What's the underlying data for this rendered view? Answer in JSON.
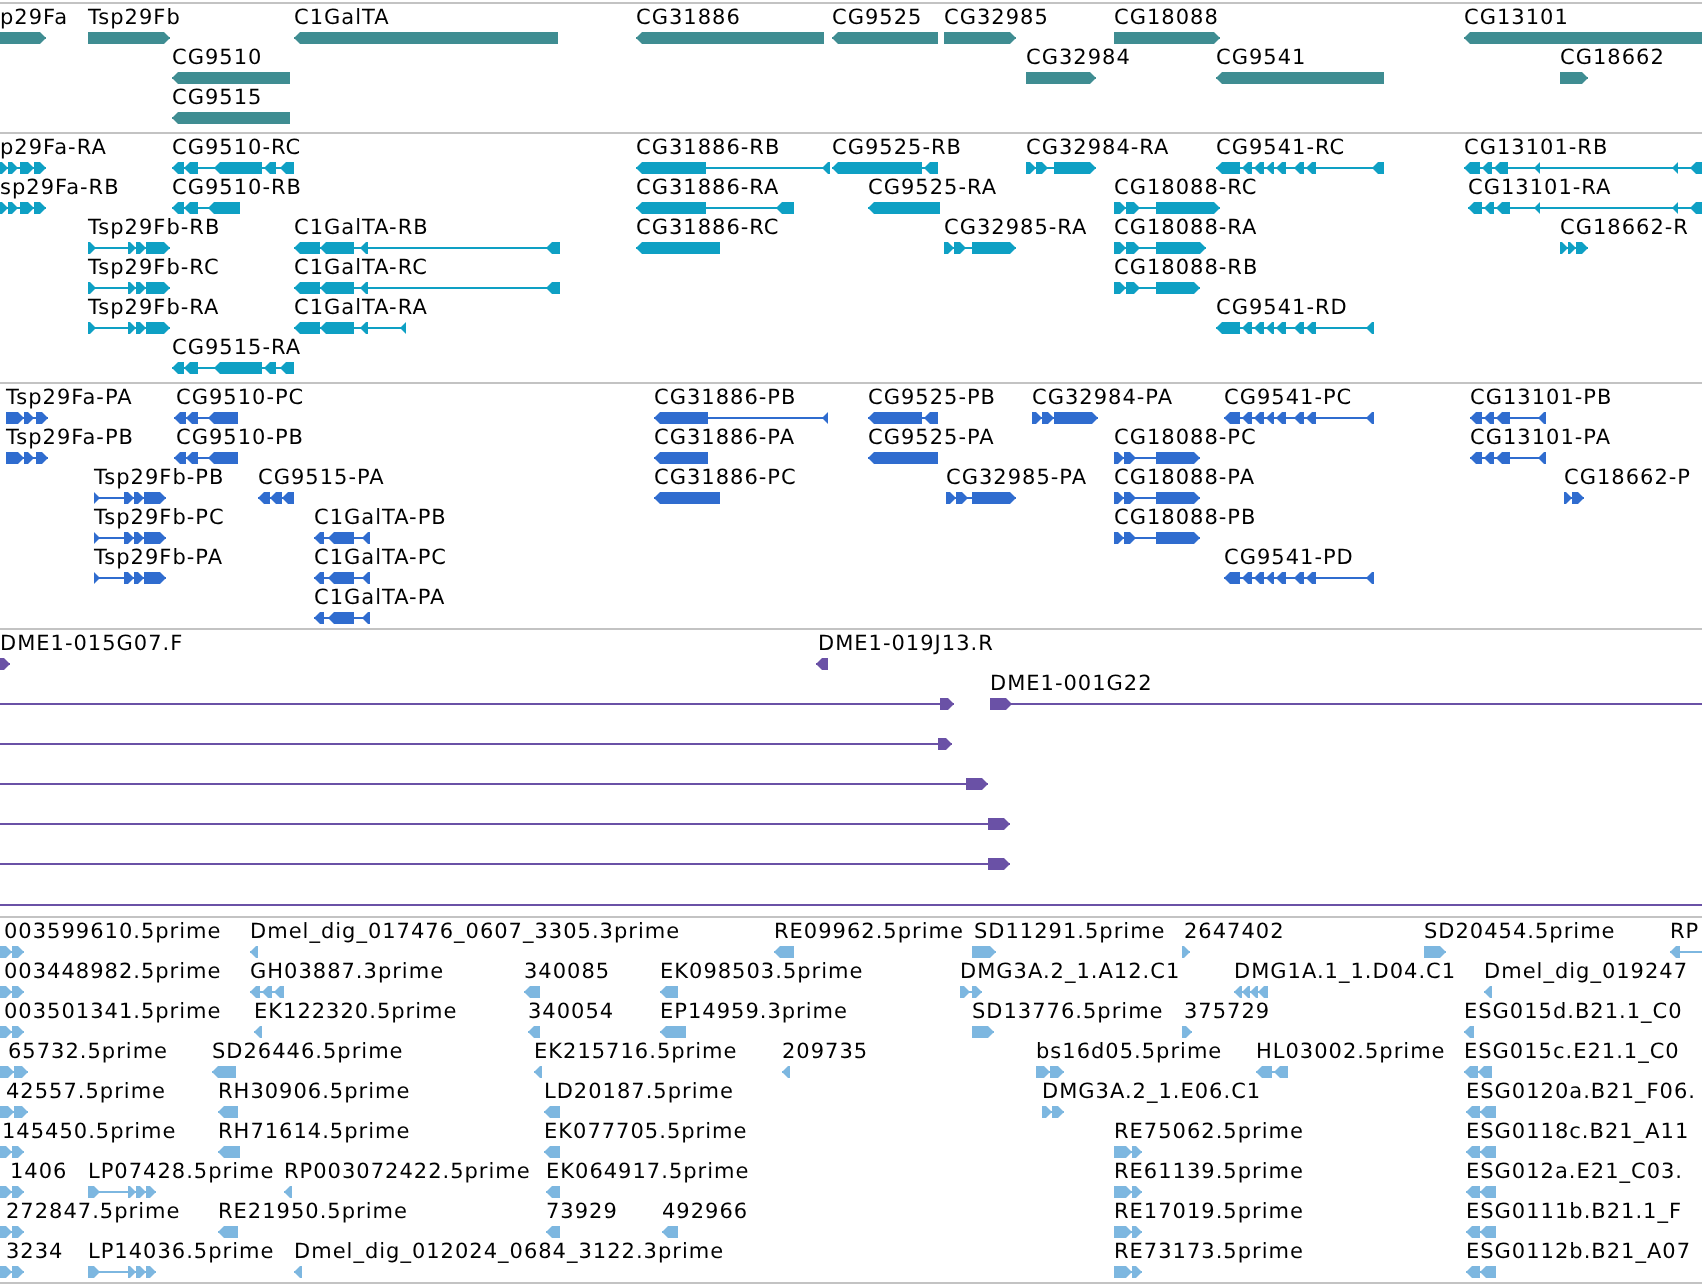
{
  "tracks": [
    {
      "kind": "gene",
      "rows": [
        {
          "features": [
            {
              "label": "p29Fa",
              "reverse": false
            },
            {
              "label": "Tsp29Fb",
              "reverse": false
            },
            {
              "label": "C1GalTA",
              "reverse": true
            },
            {
              "label": "CG31886",
              "reverse": true
            },
            {
              "label": "CG9525",
              "reverse": true
            },
            {
              "label": "CG32985",
              "reverse": false
            },
            {
              "label": "CG18088",
              "reverse": false
            },
            {
              "label": "CG13101",
              "reverse": true
            }
          ]
        },
        {
          "features": [
            {
              "label": "CG9510",
              "reverse": true
            },
            {
              "label": "CG32984",
              "reverse": false
            },
            {
              "label": "CG9541",
              "reverse": true
            },
            {
              "label": "CG18662",
              "reverse": false
            }
          ]
        },
        {
          "features": [
            {
              "label": "CG9515",
              "reverse": true
            }
          ]
        }
      ]
    },
    {
      "kind": "transcript",
      "rows": [
        {
          "features": [
            {
              "label": "p29Fa-RA",
              "reverse": false
            },
            {
              "label": "CG9510-RC",
              "reverse": true
            },
            {
              "label": "CG31886-RB",
              "reverse": true
            },
            {
              "label": "CG9525-RB",
              "reverse": true
            },
            {
              "label": "CG32984-RA",
              "reverse": false
            },
            {
              "label": "CG9541-RC",
              "reverse": true
            },
            {
              "label": "CG13101-RB",
              "reverse": true
            }
          ]
        },
        {
          "features": [
            {
              "label": "sp29Fa-RB",
              "reverse": false
            },
            {
              "label": "CG9510-RB",
              "reverse": true
            },
            {
              "label": "CG31886-RA",
              "reverse": true
            },
            {
              "label": "CG9525-RA",
              "reverse": true
            },
            {
              "label": "CG18088-RC",
              "reverse": false
            },
            {
              "label": "CG13101-RA",
              "reverse": true
            }
          ]
        },
        {
          "features": [
            {
              "label": "Tsp29Fb-RB",
              "reverse": false
            },
            {
              "label": "C1GalTA-RB",
              "reverse": true
            },
            {
              "label": "CG31886-RC",
              "reverse": true
            },
            {
              "label": "CG32985-RA",
              "reverse": false
            },
            {
              "label": "CG18088-RA",
              "reverse": false
            },
            {
              "label": "CG18662-R",
              "reverse": false
            }
          ]
        },
        {
          "features": [
            {
              "label": "Tsp29Fb-RC",
              "reverse": false
            },
            {
              "label": "C1GalTA-RC",
              "reverse": true
            },
            {
              "label": "CG18088-RB",
              "reverse": false
            }
          ]
        },
        {
          "features": [
            {
              "label": "Tsp29Fb-RA",
              "reverse": false
            },
            {
              "label": "C1GalTA-RA",
              "reverse": true
            },
            {
              "label": "CG9541-RD",
              "reverse": true
            }
          ]
        },
        {
          "features": [
            {
              "label": "CG9515-RA",
              "reverse": true
            }
          ]
        }
      ]
    },
    {
      "kind": "protein",
      "rows": [
        {
          "features": [
            {
              "label": "Tsp29Fa-PA",
              "reverse": false
            },
            {
              "label": "CG9510-PC",
              "reverse": true
            },
            {
              "label": "CG31886-PB",
              "reverse": true
            },
            {
              "label": "CG9525-PB",
              "reverse": true
            },
            {
              "label": "CG32984-PA",
              "reverse": false
            },
            {
              "label": "CG9541-PC",
              "reverse": true
            },
            {
              "label": "CG13101-PB",
              "reverse": true
            }
          ]
        },
        {
          "features": [
            {
              "label": "Tsp29Fa-PB",
              "reverse": false
            },
            {
              "label": "CG9510-PB",
              "reverse": true
            },
            {
              "label": "CG31886-PA",
              "reverse": true
            },
            {
              "label": "CG9525-PA",
              "reverse": true
            },
            {
              "label": "CG18088-PC",
              "reverse": false
            },
            {
              "label": "CG13101-PA",
              "reverse": true
            }
          ]
        },
        {
          "features": [
            {
              "label": "Tsp29Fb-PB",
              "reverse": false
            },
            {
              "label": "CG9515-PA",
              "reverse": true
            },
            {
              "label": "CG31886-PC",
              "reverse": true
            },
            {
              "label": "CG32985-PA",
              "reverse": false
            },
            {
              "label": "CG18088-PA",
              "reverse": false
            },
            {
              "label": "CG18662-P",
              "reverse": false
            }
          ]
        },
        {
          "features": [
            {
              "label": "Tsp29Fb-PC",
              "reverse": false
            },
            {
              "label": "C1GalTA-PB",
              "reverse": true
            },
            {
              "label": "CG18088-PB",
              "reverse": false
            }
          ]
        },
        {
          "features": [
            {
              "label": "Tsp29Fb-PA",
              "reverse": false
            },
            {
              "label": "C1GalTA-PC",
              "reverse": true
            },
            {
              "label": "CG9541-PD",
              "reverse": true
            }
          ]
        },
        {
          "features": [
            {
              "label": "C1GalTA-PA",
              "reverse": true
            }
          ]
        }
      ]
    },
    {
      "kind": "clone",
      "rows": [
        {
          "features": [
            {
              "label": "DME1-015G07.F",
              "reverse": false
            },
            {
              "label": "DME1-019J13.R",
              "reverse": true
            }
          ]
        },
        {
          "features": [
            {
              "reverse": false
            },
            {
              "label": "DME1-001G22",
              "reverse": false
            }
          ]
        },
        {
          "features": [
            {
              "reverse": false
            }
          ]
        },
        {
          "features": [
            {
              "reverse": false
            }
          ]
        },
        {
          "features": [
            {
              "reverse": false
            }
          ]
        },
        {
          "features": [
            {
              "reverse": false
            }
          ]
        }
      ]
    },
    {
      "kind": "est",
      "rows": [
        {
          "features": [
            {
              "label": "003599610.5prime",
              "reverse": false
            },
            {
              "label": "Dmel_dig_017476_0607_3305.3prime",
              "reverse": true
            },
            {
              "label": "RE09962.5prime",
              "reverse": true
            },
            {
              "label": "SD11291.5prime",
              "reverse": false
            },
            {
              "label": "2647402",
              "reverse": false
            },
            {
              "label": "SD20454.5prime",
              "reverse": false
            },
            {
              "label": "RP",
              "reverse": true
            }
          ]
        },
        {
          "features": [
            {
              "label": "003448982.5prime",
              "reverse": false
            },
            {
              "label": "GH03887.3prime",
              "reverse": true
            },
            {
              "label": "340085",
              "reverse": true
            },
            {
              "label": "EK098503.5prime",
              "reverse": true
            },
            {
              "label": "DMG3A.2_1.A12.C1",
              "reverse": false
            },
            {
              "label": "DMG1A.1_1.D04.C1",
              "reverse": true
            },
            {
              "label": "Dmel_dig_019247",
              "reverse": true
            }
          ]
        },
        {
          "features": [
            {
              "label": "003501341.5prime",
              "reverse": false
            },
            {
              "label": "EK122320.5prime",
              "reverse": true
            },
            {
              "label": "340054",
              "reverse": true
            },
            {
              "label": "EP14959.3prime",
              "reverse": true
            },
            {
              "label": "SD13776.5prime",
              "reverse": false
            },
            {
              "label": "375729",
              "reverse": false
            },
            {
              "label": "ESG015d.B21.1_C0",
              "reverse": true
            }
          ]
        },
        {
          "features": [
            {
              "label": "65732.5prime",
              "reverse": false
            },
            {
              "label": "SD26446.5prime",
              "reverse": true
            },
            {
              "label": "EK215716.5prime",
              "reverse": true
            },
            {
              "label": "209735",
              "reverse": true
            },
            {
              "label": "bs16d05.5prime",
              "reverse": false
            },
            {
              "label": "HL03002.5prime",
              "reverse": true
            },
            {
              "label": "ESG015c.E21.1_C0",
              "reverse": true
            }
          ]
        },
        {
          "features": [
            {
              "label": "42557.5prime",
              "reverse": false
            },
            {
              "label": "RH30906.5prime",
              "reverse": true
            },
            {
              "label": "LD20187.5prime",
              "reverse": true
            },
            {
              "label": "DMG3A.2_1.E06.C1",
              "reverse": false
            },
            {
              "label": "ESG0120a.B21_F06.",
              "reverse": true
            }
          ]
        },
        {
          "features": [
            {
              "label": "145450.5prime",
              "reverse": false
            },
            {
              "label": "RH71614.5prime",
              "reverse": true
            },
            {
              "label": "EK077705.5prime",
              "reverse": true
            },
            {
              "label": "RE75062.5prime",
              "reverse": false
            },
            {
              "label": "ESG0118c.B21_A11",
              "reverse": true
            }
          ]
        },
        {
          "features": [
            {
              "label": "1406",
              "reverse": false
            },
            {
              "label": "LP07428.5prime",
              "reverse": false
            },
            {
              "label": "RP003072422.5prime",
              "reverse": true
            },
            {
              "label": "EK064917.5prime",
              "reverse": true
            },
            {
              "label": "RE61139.5prime",
              "reverse": false
            },
            {
              "label": "ESG012a.E21_C03.",
              "reverse": true
            }
          ]
        },
        {
          "features": [
            {
              "label": "272847.5prime",
              "reverse": false
            },
            {
              "label": "RE21950.5prime",
              "reverse": true
            },
            {
              "label": "73929",
              "reverse": true
            },
            {
              "label": "492966",
              "reverse": true
            },
            {
              "label": "RE17019.5prime",
              "reverse": false
            },
            {
              "label": "ESG0111b.B21.1_F",
              "reverse": true
            }
          ]
        },
        {
          "features": [
            {
              "label": "3234",
              "reverse": false
            },
            {
              "label": "LP14036.5prime",
              "reverse": false
            },
            {
              "label": "Dmel_dig_012024_0684_3122.3prime",
              "reverse": true
            },
            {
              "label": "RE73173.5prime",
              "reverse": false
            },
            {
              "label": "ESG0112b.B21_A07",
              "reverse": true
            }
          ]
        }
      ]
    }
  ]
}
